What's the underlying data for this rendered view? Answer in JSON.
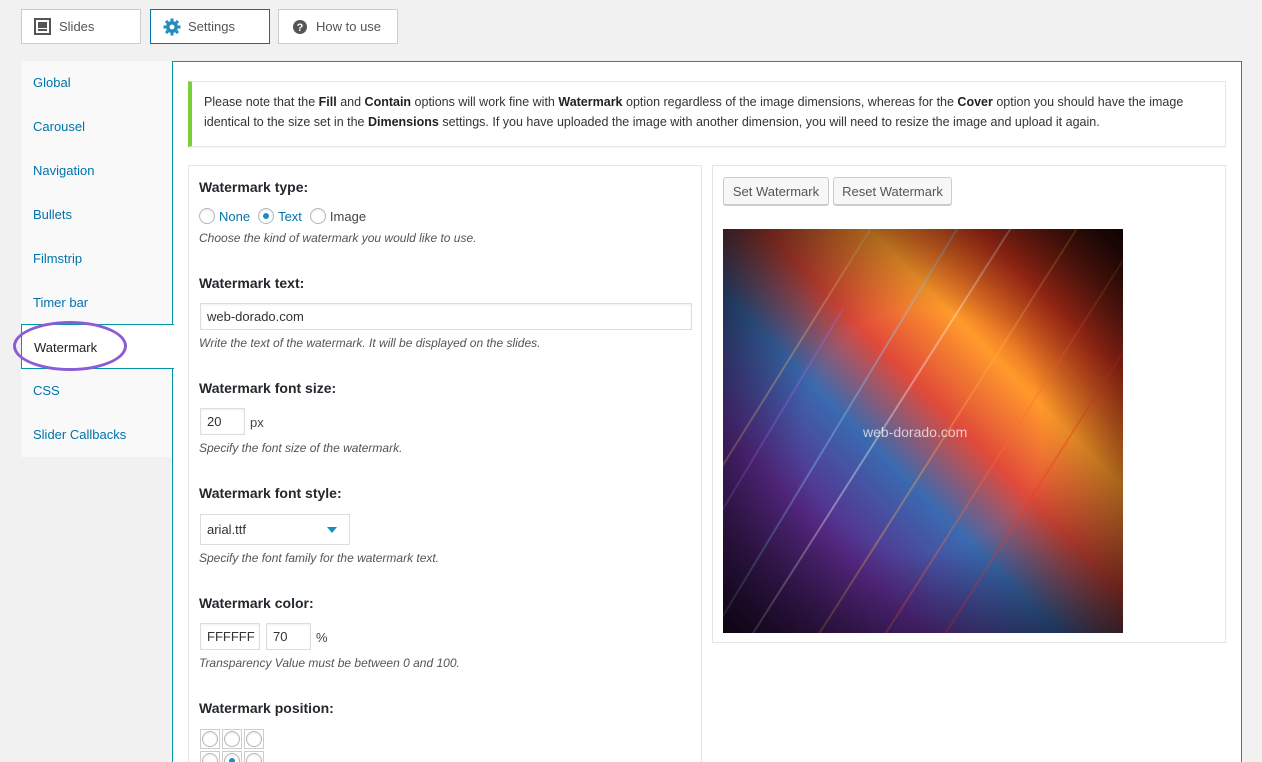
{
  "tabs": [
    {
      "label": "Slides",
      "icon": "slides-icon"
    },
    {
      "label": "Settings",
      "icon": "gear-icon"
    },
    {
      "label": "How to use",
      "icon": "help-icon"
    }
  ],
  "sidebar": {
    "items": [
      "Global",
      "Carousel",
      "Navigation",
      "Bullets",
      "Filmstrip",
      "Timer bar",
      "Watermark",
      "CSS",
      "Slider Callbacks"
    ],
    "active": "Watermark"
  },
  "notice": {
    "p1": "Please note that the ",
    "b1": "Fill",
    "p2": " and ",
    "b2": "Contain",
    "p3": " options will work fine with ",
    "b3": "Watermark",
    "p4": " option regardless of the image dimensions, whereas for the ",
    "b4": "Cover",
    "p5": " option you should have the image identical to the size set in the ",
    "b5": "Dimensions",
    "p6": " settings. If you have uploaded the image with another dimension, you will need to resize the image and upload it again."
  },
  "watermark_type": {
    "label": "Watermark type:",
    "options": [
      "None",
      "Text",
      "Image"
    ],
    "selected": "Text",
    "desc": "Choose the kind of watermark you would like to use."
  },
  "watermark_text": {
    "label": "Watermark text:",
    "value": "web-dorado.com",
    "desc": "Write the text of the watermark. It will be displayed on the slides."
  },
  "font_size": {
    "label": "Watermark font size:",
    "value": "20",
    "unit": "px",
    "desc": "Specify the font size of the watermark."
  },
  "font_style": {
    "label": "Watermark font style:",
    "value": "arial.ttf",
    "desc": "Specify the font family for the watermark text."
  },
  "color": {
    "label": "Watermark color:",
    "value": "FFFFFF",
    "transparency": "70",
    "unit": "%",
    "desc": "Transparency Value must be between 0 and 100."
  },
  "position": {
    "label": "Watermark position:"
  },
  "buttons": {
    "set": "Set Watermark",
    "reset": "Reset Watermark"
  },
  "preview": {
    "watermark": "web-dorado.com"
  },
  "colors": {
    "accent": "#0073aa",
    "border_active": "#0097a7",
    "notice_bar": "#7ad03a",
    "highlight_ellipse": "#8a5cd6"
  }
}
